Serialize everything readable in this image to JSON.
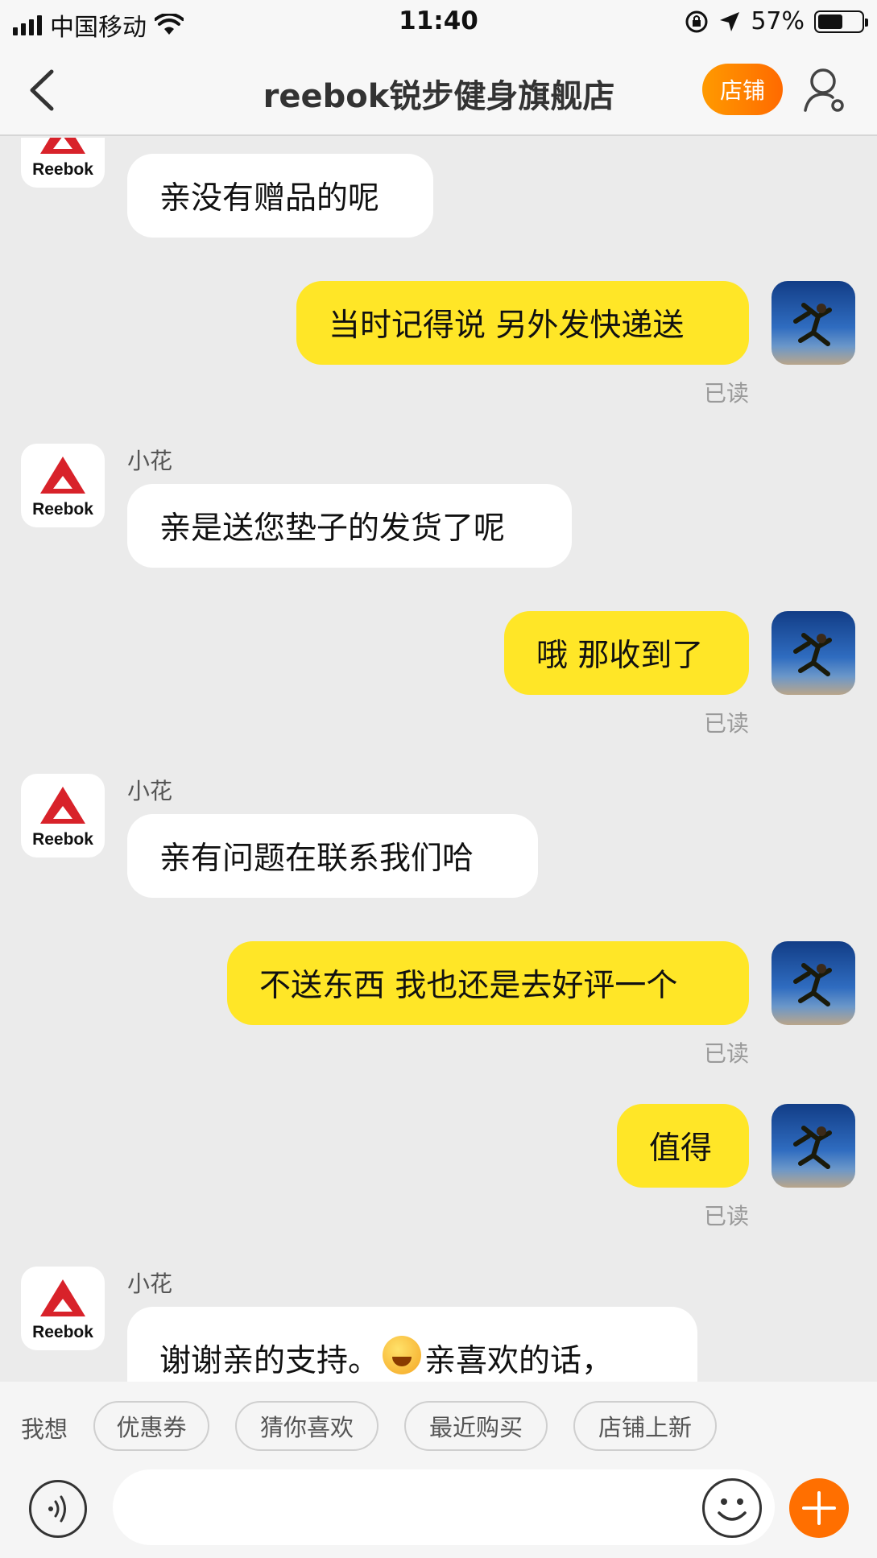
{
  "status_bar": {
    "carrier": "中国移动",
    "time": "11:40",
    "battery": "57%"
  },
  "nav": {
    "title": "reebok锐步健身旗舰店",
    "shop_button": "店铺"
  },
  "colors": {
    "accent": "#ff7a00",
    "outgoing_bubble": "#ffe627",
    "incoming_bubble": "#ffffff",
    "background": "#ebebeb"
  },
  "messages": [
    {
      "from": "shop",
      "sender": "小花",
      "text": "亲没有赠品的呢"
    },
    {
      "from": "me",
      "text": "当时记得说 另外发快递送",
      "status": "已读"
    },
    {
      "from": "shop",
      "sender": "小花",
      "text": "亲是送您垫子的发货了呢"
    },
    {
      "from": "me",
      "text": "哦 那收到了",
      "status": "已读"
    },
    {
      "from": "shop",
      "sender": "小花",
      "text": "亲有问题在联系我们哈"
    },
    {
      "from": "me",
      "text": "不送东西 我也还是去好评一个",
      "status": "已读"
    },
    {
      "from": "me",
      "text": "值得",
      "status": "已读"
    },
    {
      "from": "shop",
      "sender": "小花",
      "text_before_emoji": "谢谢亲的支持。",
      "emoji": "laughing-emoji",
      "text_after_emoji": "亲喜欢的话，"
    }
  ],
  "shop_avatar_logo": "Reebok",
  "quick_bar": {
    "label": "我想",
    "chips": [
      "优惠券",
      "猜你喜欢",
      "最近购买",
      "店铺上新"
    ]
  },
  "input": {
    "placeholder": ""
  }
}
